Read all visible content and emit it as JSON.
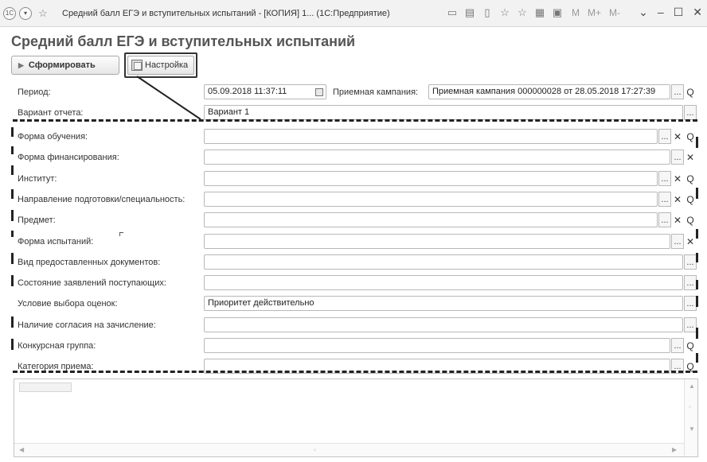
{
  "window": {
    "title": "Средний балл ЕГЭ и вступительных испытаний - [КОПИЯ] 1... (1С:Предприятие)",
    "m_labels": [
      "M",
      "M+",
      "M-"
    ],
    "controls": [
      "⌄",
      "–",
      "☐",
      "✕"
    ]
  },
  "form": {
    "title": "Средний балл ЕГЭ и вступительных испытаний",
    "generate_label": "Сформировать",
    "settings_label": "Настройка"
  },
  "header_fields": {
    "period_label": "Период:",
    "period_value": "05.09.2018 11:37:11",
    "campaign_label": "Приемная кампания:",
    "campaign_value": "Приемная кампания 000000028 от 28.05.2018 17:27:39",
    "variant_label": "Вариант отчета:",
    "variant_value": "Вариант 1"
  },
  "filters": [
    {
      "label": "Форма обучения:",
      "value": "",
      "buttons": [
        "...",
        "✕",
        "Q"
      ]
    },
    {
      "label": "Форма финансирования:",
      "value": "",
      "buttons": [
        "...",
        "✕"
      ]
    },
    {
      "label": "Институт:",
      "value": "",
      "buttons": [
        "...",
        "✕",
        "Q"
      ]
    },
    {
      "label": "Направление подготовки/специальность:",
      "value": "",
      "buttons": [
        "...",
        "✕",
        "Q"
      ]
    },
    {
      "label": "Предмет:",
      "value": "",
      "buttons": [
        "...",
        "✕",
        "Q"
      ]
    },
    {
      "label": "Форма испытаний:",
      "value": "",
      "buttons": [
        "...",
        "✕"
      ]
    },
    {
      "label": "Вид предоставленных документов:",
      "value": "",
      "buttons": [
        "..."
      ]
    },
    {
      "label": "Состояние заявлений поступающих:",
      "value": "",
      "buttons": [
        "..."
      ]
    },
    {
      "label": "Условие выбора оценок:",
      "value": "Приоритет действительно",
      "buttons": [
        "..."
      ]
    },
    {
      "label": "Наличие согласия на зачисление:",
      "value": "",
      "buttons": [
        "..."
      ]
    },
    {
      "label": "Конкурсная группа:",
      "value": "",
      "buttons": [
        "...",
        "Q"
      ]
    },
    {
      "label": "Категория приема:",
      "value": "",
      "buttons": [
        "...",
        "Q"
      ]
    }
  ]
}
